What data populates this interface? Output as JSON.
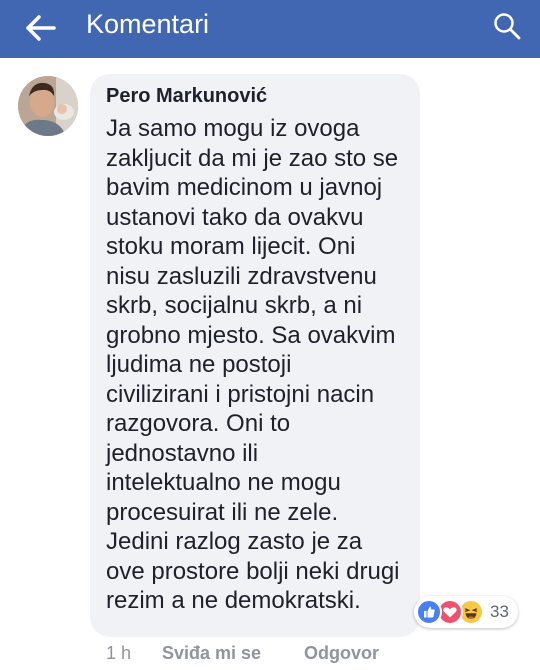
{
  "header": {
    "title": "Komentari",
    "back_icon": "arrow-left-icon",
    "search_icon": "search-icon",
    "bg_color": "#4267b2"
  },
  "comment": {
    "author": "Pero Markunović",
    "text_lines": [
      "Ja samo mogu iz ovoga",
      "zakljucit da mi je zao sto se",
      "bavim medicinom  u javnoj",
      "ustanovi tako da ovakvu",
      "stoku moram lijecit. Oni",
      "nisu zasluzili zdravstvenu",
      "skrb, socijalnu skrb, a ni",
      "grobno mjesto. Sa ovakvim",
      "ljudima ne postoji",
      "civilizirani i pristojni nacin",
      "razgovora. Oni to",
      "jednostavno ili",
      "intelektualno ne mogu",
      "procesuirat ili ne zele.",
      "Jedini razlog zasto je za",
      "ove prostore bolji neki drugi",
      "rezim a ne demokratski."
    ],
    "reactions": {
      "icons": [
        "like-icon",
        "love-icon",
        "haha-icon"
      ],
      "count": "33"
    },
    "actions": {
      "time": "1 h",
      "like": "Sviđa mi se",
      "reply": "Odgovor"
    }
  }
}
